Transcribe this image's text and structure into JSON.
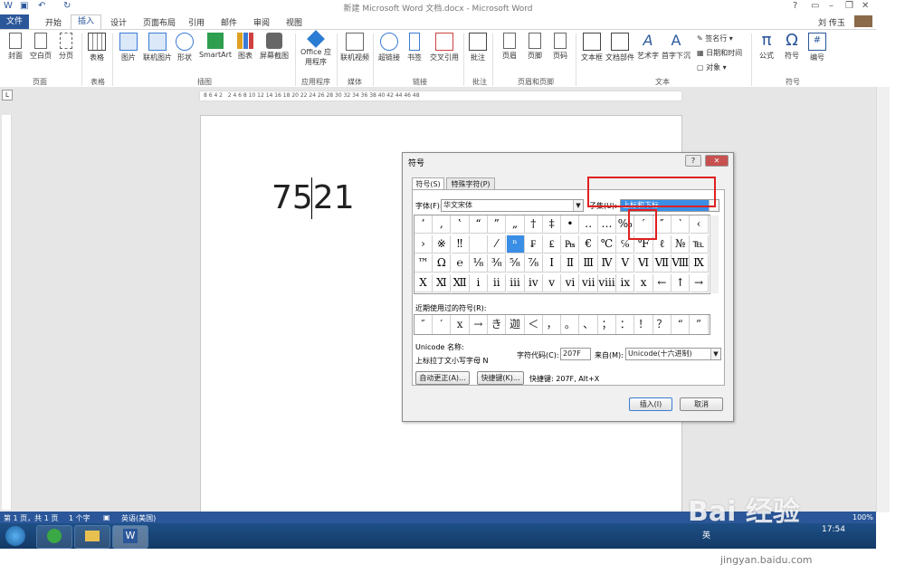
{
  "window": {
    "title": "新建 Microsoft Word 文档.docx - Microsoft Word",
    "user": "刘 传玉",
    "help": "?"
  },
  "tabs": [
    "文件",
    "开始",
    "插入",
    "设计",
    "页面布局",
    "引用",
    "邮件",
    "审阅",
    "视图"
  ],
  "ribbon": {
    "buttons": [
      "封面",
      "空白页",
      "分页",
      "表格",
      "图片",
      "联机图片",
      "形状",
      "SmartArt",
      "图表",
      "屏幕截图",
      "Office 应用程序",
      "联机视频",
      "超链接",
      "书签",
      "交叉引用",
      "批注",
      "页眉",
      "页脚",
      "页码",
      "文本框",
      "文档部件",
      "艺术字",
      "首字下沉",
      "公式",
      "符号",
      "编号"
    ],
    "small": [
      "签名行",
      "日期和时间",
      "对象"
    ],
    "groups": [
      "页面",
      "表格",
      "插图",
      "应用程序",
      "媒体",
      "链接",
      "批注",
      "页眉和页脚",
      "文本",
      "符号"
    ]
  },
  "ruler_numbers": "8 6 4 2   2 4 6 8 10 12 14 16 18 20 22 24 26 28 30 32 34 36 38 40 42 44 46 48",
  "document": {
    "text": "7521"
  },
  "statusbar": {
    "page": "第 1 页，共 1 页",
    "words": "1 个字",
    "lang": "英语(美国)",
    "zoom": "100%"
  },
  "taskbar": {
    "time": "17:54",
    "ime": "英"
  },
  "dialog": {
    "title": "符号",
    "tabs": [
      "符号(S)",
      "特殊字符(P)"
    ],
    "font_label": "字体(F):",
    "font_value": "华文宋体",
    "subset_label": "子集(U):",
    "subset_value": "上标和下标",
    "grid_rows": [
      [
        "’",
        "‚",
        "‛",
        "“",
        "”",
        "„",
        "†",
        "‡",
        "•",
        "‥",
        "…",
        "‰",
        "′",
        "″",
        "‵",
        "‹"
      ],
      [
        "›",
        "※",
        "‼",
        "",
        "⁄",
        "ⁿ",
        "₣",
        "₤",
        "₧",
        "€",
        "℃",
        "℅",
        "℉",
        "ℓ",
        "№",
        "℡"
      ],
      [
        "™",
        "Ω",
        "℮",
        "⅛",
        "⅜",
        "⅝",
        "⅞",
        "Ⅰ",
        "Ⅱ",
        "Ⅲ",
        "Ⅳ",
        "Ⅴ",
        "Ⅵ",
        "Ⅶ",
        "Ⅷ",
        "Ⅸ"
      ],
      [
        "Ⅹ",
        "Ⅺ",
        "Ⅻ",
        "ⅰ",
        "ⅱ",
        "ⅲ",
        "ⅳ",
        "ⅴ",
        "ⅵ",
        "ⅶ",
        "ⅷ",
        "ⅸ",
        "ⅹ",
        "←",
        "↑",
        "→"
      ]
    ],
    "selected": "ⁿ",
    "recent_label": "近期使用过的符号(R):",
    "recent": [
      "″",
      "′",
      "x",
      "→",
      "き",
      "迦",
      "＜",
      "，",
      "。",
      "、",
      "；",
      "：",
      "！",
      "？",
      "“",
      "”"
    ],
    "unicode_label": "Unicode 名称:",
    "unicode_name": "上标拉丁文小写字母 N",
    "code_label": "字符代码(C):",
    "code_value": "207F",
    "from_label": "来自(M):",
    "from_value": "Unicode(十六进制)",
    "autocorrect": "自动更正(A)...",
    "shortcut_btn": "快捷键(K)...",
    "shortcut_text": "快捷键: 207F, Alt+X",
    "insert": "插入(I)",
    "cancel": "取消"
  },
  "watermark": {
    "brand": "Bai 经验",
    "url": "jingyan.baidu.com"
  },
  "colors": {
    "accent": "#2b579a",
    "highlight": "#e02020",
    "selection": "#3a8ee6"
  }
}
